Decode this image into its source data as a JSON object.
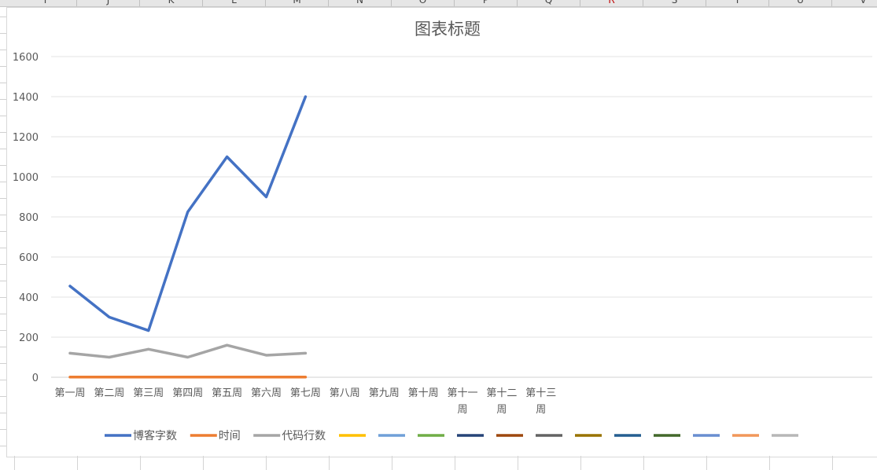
{
  "sheet": {
    "columns": [
      "I",
      "J",
      "K",
      "L",
      "M",
      "N",
      "O",
      "P",
      "Q",
      "R",
      "S",
      "T",
      "U",
      "V"
    ]
  },
  "chart_data": {
    "type": "line",
    "title": "图表标题",
    "categories": [
      "第一周",
      "第二周",
      "第三周",
      "第四周",
      "第五周",
      "第六周",
      "第七周",
      "第八周",
      "第九周",
      "第十周",
      "第十一周",
      "第十二周",
      "第十三周"
    ],
    "category_lines": [
      [
        "第一周"
      ],
      [
        "第二周"
      ],
      [
        "第三周"
      ],
      [
        "第四周"
      ],
      [
        "第五周"
      ],
      [
        "第六周"
      ],
      [
        "第七周"
      ],
      [
        "第八周"
      ],
      [
        "第九周"
      ],
      [
        "第十周"
      ],
      [
        "第十一",
        "周"
      ],
      [
        "第十二",
        "周"
      ],
      [
        "第十三",
        "周"
      ]
    ],
    "ylim": [
      0,
      1600
    ],
    "yticks": [
      0,
      200,
      400,
      600,
      800,
      1000,
      1200,
      1400,
      1600
    ],
    "grid": true,
    "legend_position": "bottom",
    "series": [
      {
        "name": "博客字数",
        "color": "#4472c4",
        "values": [
          455,
          300,
          233,
          825,
          1100,
          900,
          1400
        ]
      },
      {
        "name": "时间",
        "color": "#ed7d31",
        "values": [
          1,
          1,
          1,
          1,
          1,
          1,
          1
        ]
      },
      {
        "name": "代码行数",
        "color": "#a5a5a5",
        "values": [
          120,
          100,
          140,
          100,
          160,
          110,
          120
        ]
      },
      {
        "name": "",
        "color": "#ffc000",
        "values": []
      },
      {
        "name": "",
        "color": "#70a0d8",
        "values": []
      },
      {
        "name": "",
        "color": "#70ad47",
        "values": []
      },
      {
        "name": "",
        "color": "#264478",
        "values": []
      },
      {
        "name": "",
        "color": "#9e480e",
        "values": []
      },
      {
        "name": "",
        "color": "#636363",
        "values": []
      },
      {
        "name": "",
        "color": "#997300",
        "values": []
      },
      {
        "name": "",
        "color": "#255e91",
        "values": []
      },
      {
        "name": "",
        "color": "#43682b",
        "values": []
      },
      {
        "name": "",
        "color": "#698ed0",
        "values": []
      },
      {
        "name": "",
        "color": "#f1975a",
        "values": []
      },
      {
        "name": "",
        "color": "#b7b7b7",
        "values": []
      }
    ]
  }
}
